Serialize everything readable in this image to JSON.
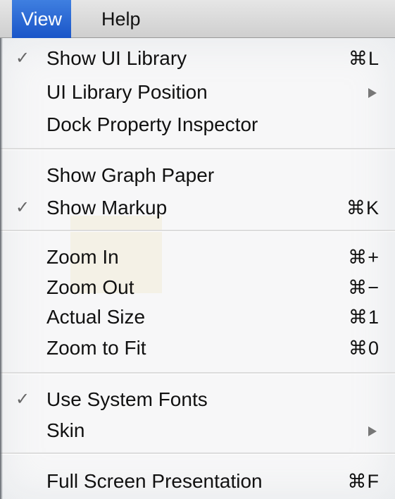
{
  "menubar": {
    "items": [
      {
        "label": "View",
        "active": true
      },
      {
        "label": "Help",
        "active": false
      }
    ]
  },
  "menu": {
    "groups": [
      [
        {
          "label": "Show UI Library",
          "checked": true,
          "shortcut": "⌘L",
          "submenu": false
        },
        {
          "label": "UI Library Position",
          "checked": false,
          "shortcut": "",
          "submenu": true
        },
        {
          "label": "Dock Property Inspector",
          "checked": false,
          "shortcut": "",
          "submenu": false
        }
      ],
      [
        {
          "label": "Show Graph Paper",
          "checked": false,
          "shortcut": "",
          "submenu": false
        },
        {
          "label": "Show Markup",
          "checked": true,
          "shortcut": "⌘K",
          "submenu": false
        }
      ],
      [
        {
          "label": "Zoom In",
          "checked": false,
          "shortcut": "⌘+",
          "submenu": false
        },
        {
          "label": "Zoom Out",
          "checked": false,
          "shortcut": "⌘−",
          "submenu": false
        },
        {
          "label": "Actual Size",
          "checked": false,
          "shortcut": "⌘1",
          "submenu": false
        },
        {
          "label": "Zoom to Fit",
          "checked": false,
          "shortcut": "⌘0",
          "submenu": false
        }
      ],
      [
        {
          "label": "Use System Fonts",
          "checked": true,
          "shortcut": "",
          "submenu": false
        },
        {
          "label": "Skin",
          "checked": false,
          "shortcut": "",
          "submenu": true
        }
      ],
      [
        {
          "label": "Full Screen Presentation",
          "checked": false,
          "shortcut": "⌘F",
          "submenu": false
        }
      ]
    ],
    "check_glyph": "✓",
    "check_icon": "checkmark-icon",
    "submenu_icon": "submenu-arrow-icon"
  },
  "colors": {
    "active_menu": "#1f5fd6",
    "menu_background": "#f7f7f8"
  }
}
